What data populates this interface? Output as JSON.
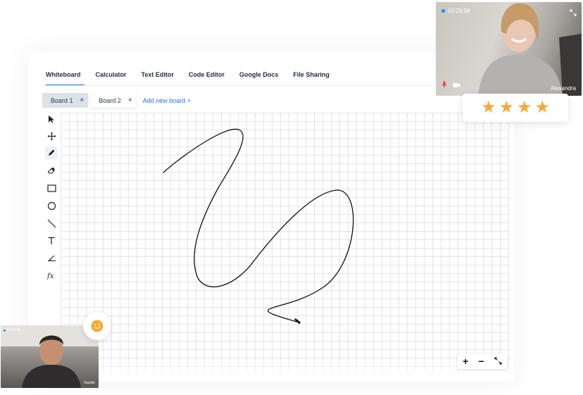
{
  "tabs": [
    {
      "label": "Whiteboard",
      "active": true
    },
    {
      "label": "Calculator"
    },
    {
      "label": "Text Editor"
    },
    {
      "label": "Code Editor"
    },
    {
      "label": "Google Docs"
    },
    {
      "label": "File Sharing"
    }
  ],
  "boards": [
    {
      "label": "Board 1",
      "close": "×"
    },
    {
      "label": "Board 2",
      "close": "×"
    }
  ],
  "add_board_label": "Add new board +",
  "tools": [
    "pointer-icon",
    "move-icon",
    "pencil-icon",
    "eraser-icon",
    "rectangle-icon",
    "circle-icon",
    "line-icon",
    "text-icon",
    "ruler-icon",
    "formula-icon"
  ],
  "zoom": {
    "plus": "+",
    "minus": "−"
  },
  "video_top": {
    "timer": "00:29:38",
    "name": "Alexandra"
  },
  "rating": {
    "stars": 4,
    "star_char": "★"
  },
  "video_bottom": {
    "timer": "00:00:02",
    "name": "Danish"
  },
  "colors": {
    "accent": "#1a73e8",
    "star": "#f6a93b",
    "emoji": "#f6a93b",
    "grid": "#e3e5e9"
  }
}
